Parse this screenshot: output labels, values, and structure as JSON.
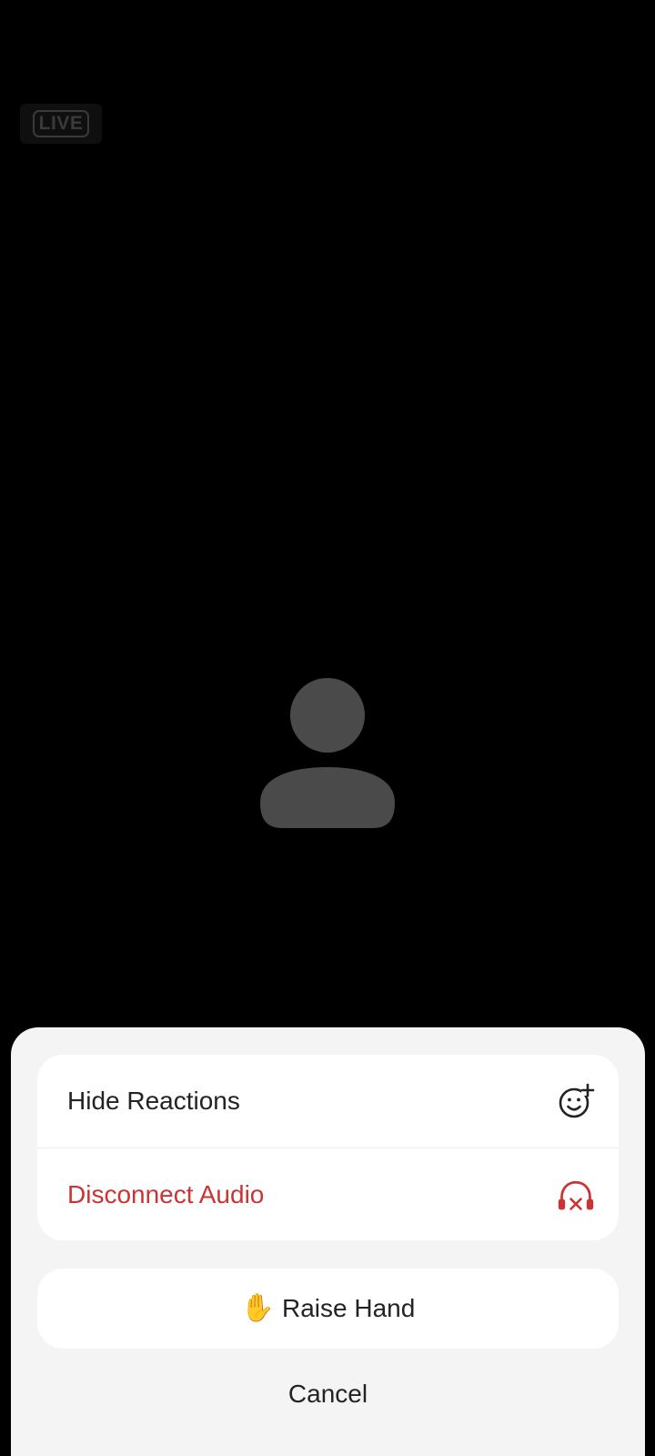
{
  "badge": {
    "live_text": "LIVE"
  },
  "avatar": {
    "icon": "person-icon",
    "color": "#4a4a4a"
  },
  "action_sheet": {
    "items": [
      {
        "label": "Hide Reactions",
        "icon": "add-reaction-icon",
        "color": "#232323"
      },
      {
        "label": "Disconnect Audio",
        "icon": "headphones-disconnect-icon",
        "color": "#cc3333"
      }
    ],
    "raise_hand": {
      "emoji": "✋",
      "label": "Raise Hand"
    },
    "cancel_label": "Cancel"
  }
}
